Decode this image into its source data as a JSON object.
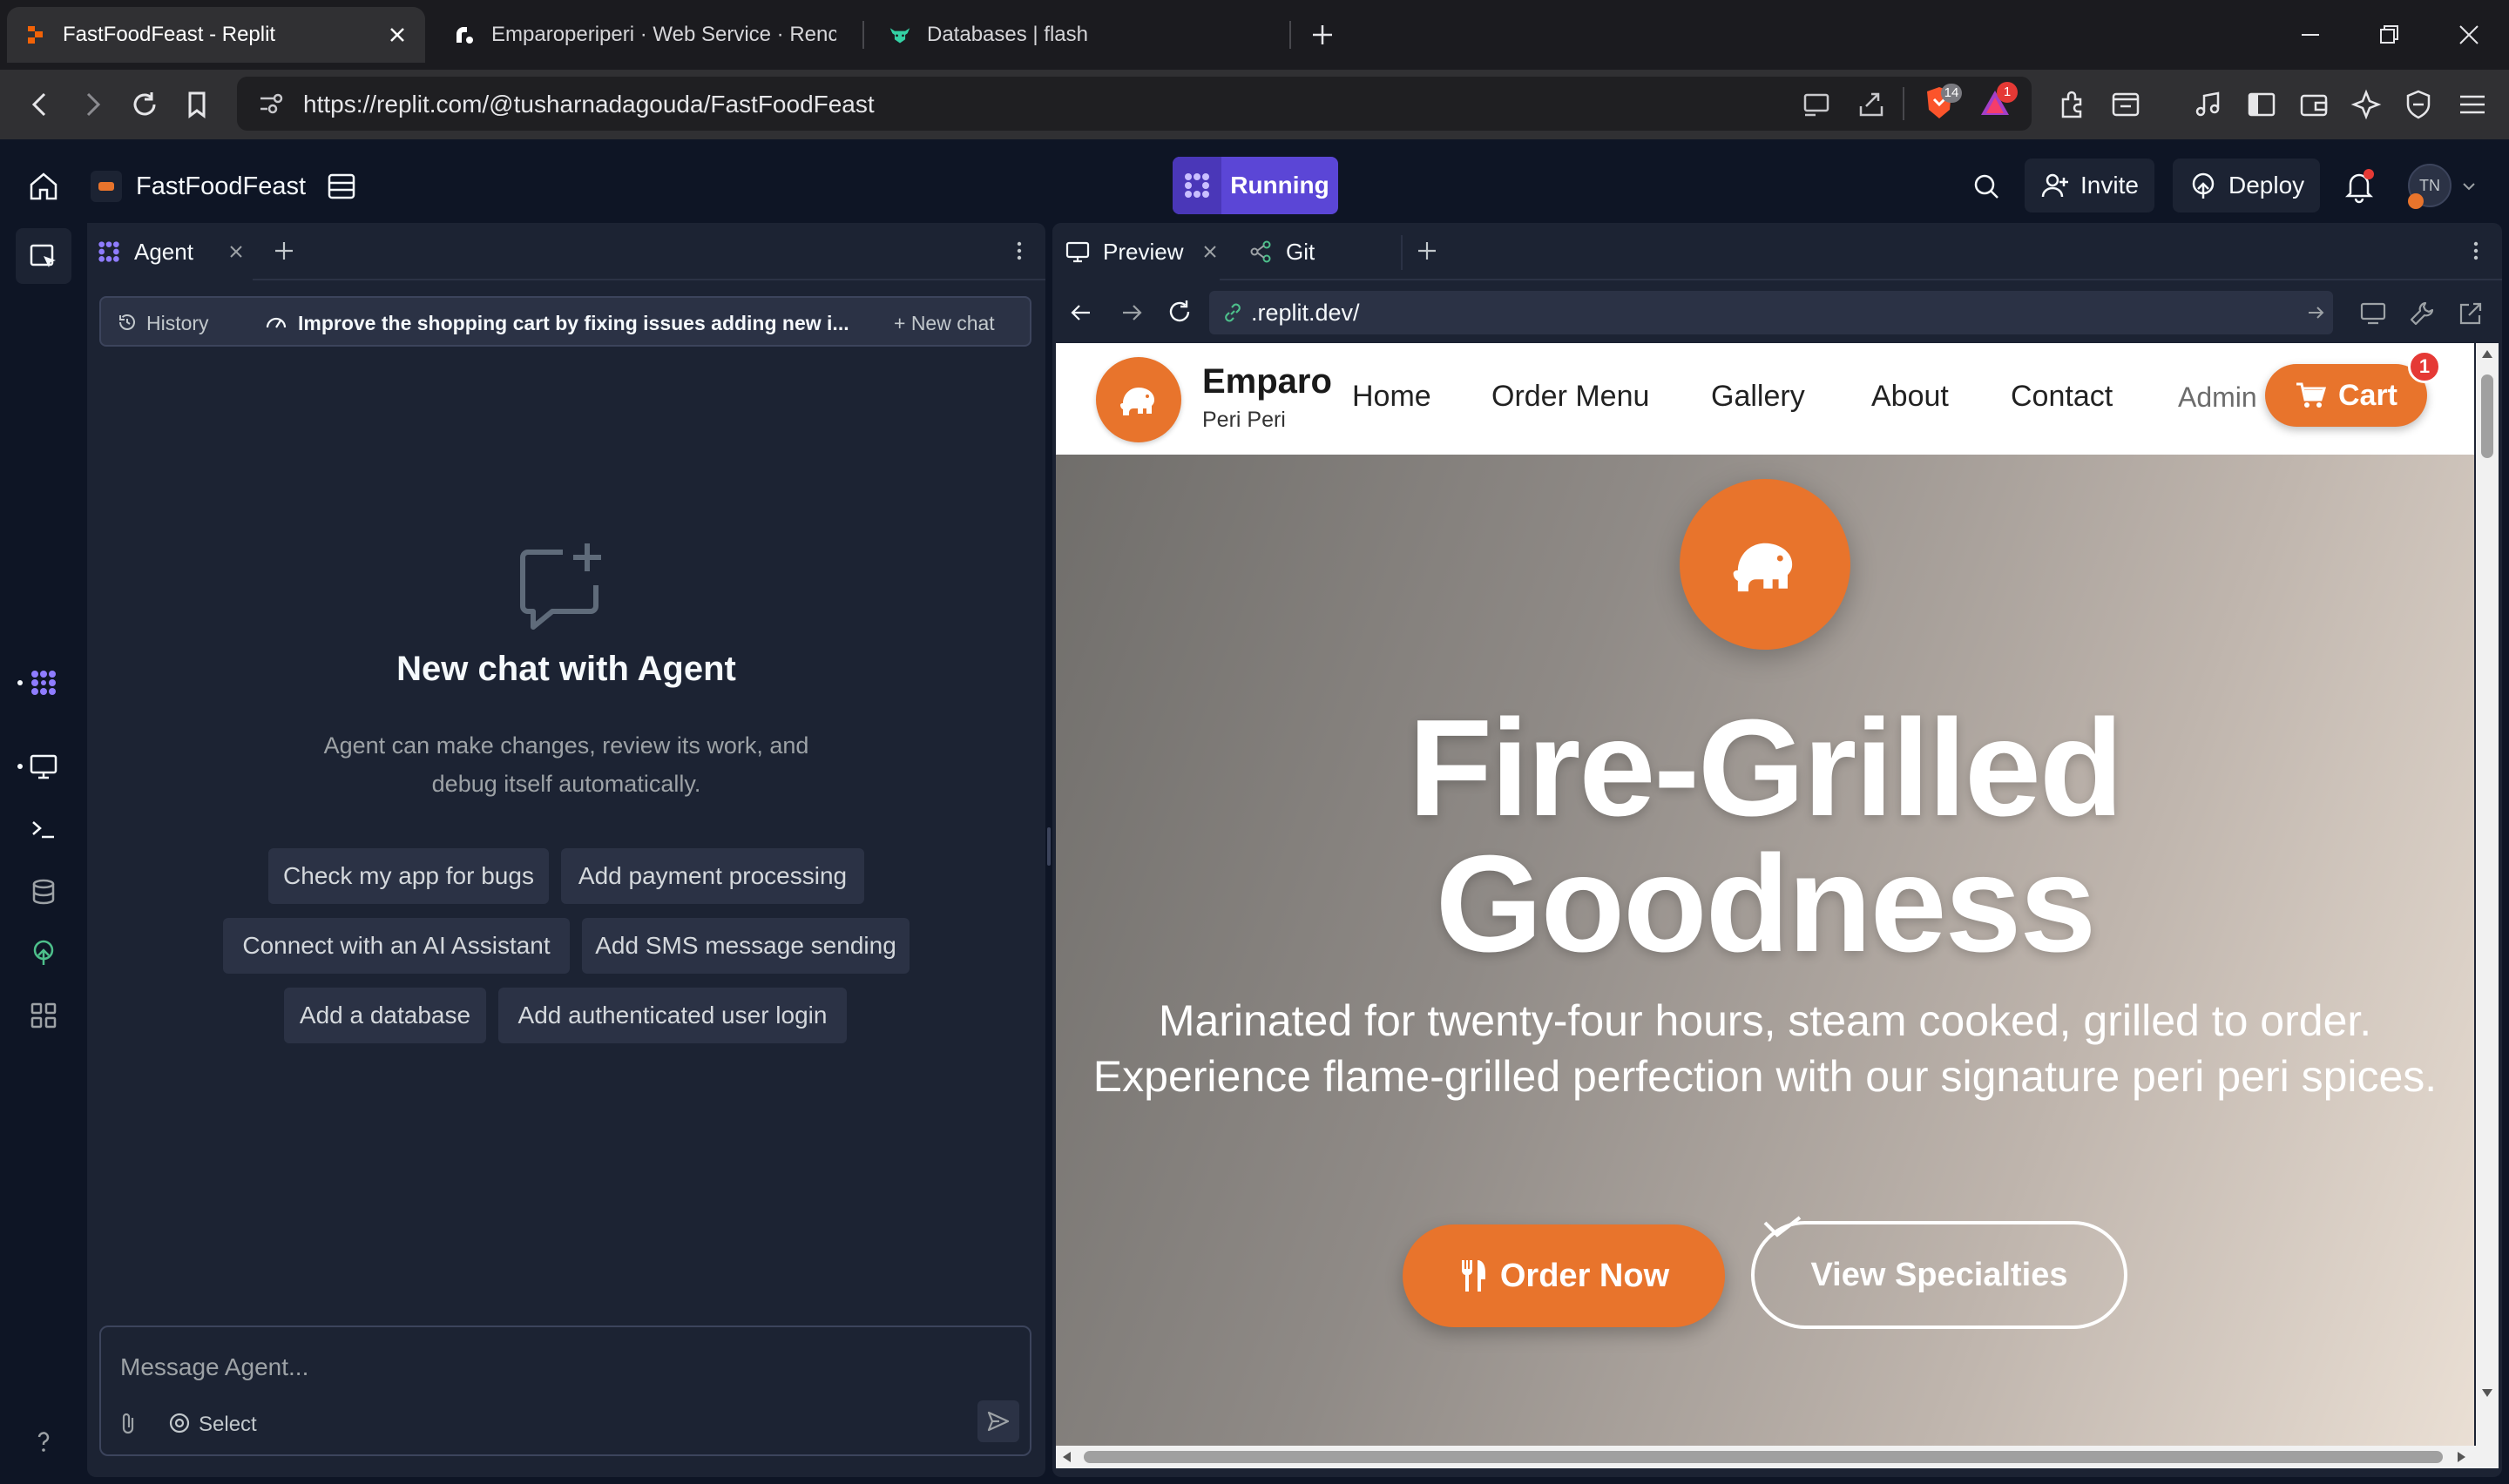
{
  "browser": {
    "tabs": [
      {
        "title": "FastFoodFeast - Replit",
        "active": true
      },
      {
        "title": "Emparoperiperi · Web Service · Renc",
        "active": false
      },
      {
        "title": "Databases | flash",
        "active": false
      }
    ],
    "url": "https://replit.com/@tusharnadagouda/FastFoodFeast",
    "brave_badge": "14",
    "alert_badge": "1"
  },
  "header": {
    "project_name": "FastFoodFeast",
    "run_status": "Running",
    "invite_label": "Invite",
    "deploy_label": "Deploy",
    "avatar_initials": "TN"
  },
  "agent": {
    "tab_label": "Agent",
    "history_label": "History",
    "current_chat": "Improve the shopping cart by fixing issues adding new i...",
    "new_chat_label": "+ New chat",
    "empty_title": "New chat with Agent",
    "empty_desc": "Agent can make changes, review its work, and debug itself automatically.",
    "suggestions": [
      "Check my app for bugs",
      "Add payment processing",
      "Connect with an AI Assistant",
      "Add SMS message sending",
      "Add a database",
      "Add authenticated user login"
    ],
    "input_placeholder": "Message Agent...",
    "select_label": "Select"
  },
  "preview": {
    "tabs": [
      "Preview",
      "Git"
    ],
    "url": ".replit.dev/"
  },
  "site": {
    "brand_name": "Emparo",
    "brand_sub": "Peri Peri",
    "nav": [
      "Home",
      "Order Menu",
      "Gallery",
      "About",
      "Contact"
    ],
    "admin_label": "Admin",
    "cart_label": "Cart",
    "cart_count": "1",
    "hero_title_line1": "Fire-Grilled",
    "hero_title_line2": "Goodness",
    "hero_sub": "Marinated for twenty-four hours, steam cooked, grilled to order. Experience flame-grilled perfection with our signature peri peri spices.",
    "order_now_label": "Order Now",
    "view_specialties_label": "View Specialties"
  },
  "colors": {
    "replit_bg": "#0e1525",
    "panel_bg": "#1c2333",
    "running_accent": "#5b46d6",
    "brand_orange": "#e8742c"
  }
}
